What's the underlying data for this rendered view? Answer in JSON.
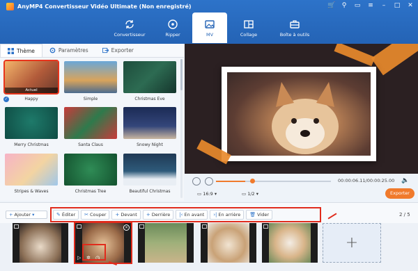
{
  "app": {
    "title": "AnyMP4 Convertisseur Vidéo Ultimate (Non enregistré)"
  },
  "nav": [
    {
      "label": "Convertisseur",
      "icon": "refresh-icon"
    },
    {
      "label": "Ripper",
      "icon": "disc-icon"
    },
    {
      "label": "MV",
      "icon": "image-icon",
      "active": true
    },
    {
      "label": "Collage",
      "icon": "collage-icon"
    },
    {
      "label": "Boîte à outils",
      "icon": "toolbox-icon"
    }
  ],
  "tabs": [
    {
      "label": "Thème",
      "active": true
    },
    {
      "label": "Paramètres"
    },
    {
      "label": "Exporter"
    }
  ],
  "themes": [
    {
      "label": "Happy",
      "badge": "Actuel",
      "selected": true
    },
    {
      "label": "Simple"
    },
    {
      "label": "Christmas Eve"
    },
    {
      "label": "Merry Christmas"
    },
    {
      "label": "Santa Claus"
    },
    {
      "label": "Snowy Night"
    },
    {
      "label": "Stripes & Waves"
    },
    {
      "label": "Christmas Tree"
    },
    {
      "label": "Beautiful Christmas"
    }
  ],
  "player": {
    "time": "00:00:06.11/00:00:25.00",
    "ratio": "16:9",
    "page": "1/2",
    "export_label": "Exporter"
  },
  "toolbar": {
    "add_label": "Ajouter",
    "tools": [
      "Éditer",
      "Couper",
      "Devant",
      "Derrière",
      "En avant",
      "En arrière",
      "Vider"
    ],
    "counter": "2 / 5"
  },
  "colors": {
    "accent": "#2463b5",
    "export": "#f07a2c",
    "highlight": "#e02b1c"
  }
}
